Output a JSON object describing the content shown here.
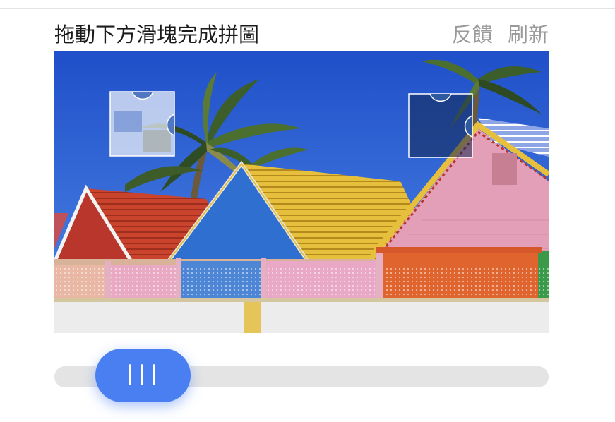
{
  "header": {
    "instruction": "拖動下方滑塊完成拼圖",
    "feedback_label": "反饋",
    "refresh_label": "刷新"
  },
  "captcha": {
    "image_subject": "colorful beach houses with palm trees",
    "puzzle_piece_icon": "puzzle-piece",
    "target_slot_icon": "puzzle-slot"
  },
  "slider": {
    "handle_icon": "grip-lines-icon",
    "position_fraction": 0.0,
    "accent_color": "#4a7ff2",
    "track_color": "#e4e4e4"
  }
}
